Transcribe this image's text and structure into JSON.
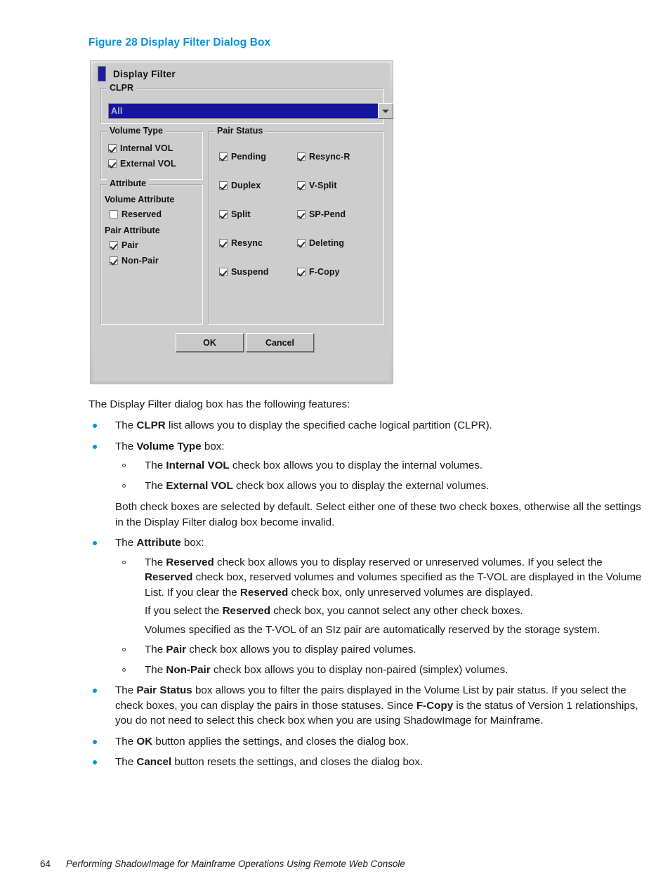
{
  "figure": {
    "caption": "Figure 28 Display Filter Dialog Box",
    "caption_color": "#0b93d5"
  },
  "dialog": {
    "title": "Display Filter",
    "title_icon": "application-icon",
    "clpr": {
      "legend": "CLPR",
      "selected_value": "All",
      "dropdown_icon": "chevron-down-icon"
    },
    "volume_type": {
      "legend": "Volume Type",
      "checkboxes": [
        {
          "label": "Internal VOL",
          "checked": true
        },
        {
          "label": "External VOL",
          "checked": true
        }
      ]
    },
    "attribute": {
      "legend": "Attribute",
      "volume_attribute_heading": "Volume Attribute",
      "volume_attribute_checkboxes": [
        {
          "label": "Reserved",
          "checked": false
        }
      ],
      "pair_attribute_heading": "Pair Attribute",
      "pair_attribute_checkboxes": [
        {
          "label": "Pair",
          "checked": true
        },
        {
          "label": "Non-Pair",
          "checked": true
        }
      ]
    },
    "pair_status": {
      "legend": "Pair Status",
      "column_left": [
        {
          "label": "Pending",
          "checked": true
        },
        {
          "label": "Duplex",
          "checked": true
        },
        {
          "label": "Split",
          "checked": true
        },
        {
          "label": "Resync",
          "checked": true
        },
        {
          "label": "Suspend",
          "checked": true
        }
      ],
      "column_right": [
        {
          "label": "Resync-R",
          "checked": true
        },
        {
          "label": "V-Split",
          "checked": true
        },
        {
          "label": "SP-Pend",
          "checked": true
        },
        {
          "label": "Deleting",
          "checked": true
        },
        {
          "label": "F-Copy",
          "checked": true
        }
      ]
    },
    "buttons": {
      "ok": "OK",
      "cancel": "Cancel"
    }
  },
  "body": {
    "lead": "The Display Filter dialog box has the following features:",
    "items": {
      "clpr": {
        "pre": "The ",
        "bold": "CLPR",
        "post": " list allows you to display the specified cache logical partition (CLPR)."
      },
      "volume_type": {
        "pre": "The ",
        "bold": "Volume Type",
        "post": " box:",
        "sub": {
          "internal": {
            "pre": "The ",
            "bold": "Internal VOL",
            "post": " check box allows you to display the internal volumes."
          },
          "external": {
            "pre": "The ",
            "bold": "External VOL",
            "post": " check box allows you to display the external volumes."
          }
        },
        "note": "Both check boxes are selected by default. Select either one of these two check boxes, otherwise all the settings in the Display Filter dialog box become invalid."
      },
      "attribute": {
        "pre": "The ",
        "bold": "Attribute",
        "post": " box:",
        "sub": {
          "reserved": {
            "p1_a": "The ",
            "p1_b1": "Reserved",
            "p1_b": " check box allows you to display reserved or unreserved volumes. If you select the ",
            "p1_b2": "Reserved",
            "p1_c": " check box, reserved volumes and volumes specified as the T-VOL are displayed in the Volume List. If you clear the ",
            "p1_b3": "Reserved",
            "p1_d": " check box, only unreserved volumes are displayed.",
            "p2_a": "If you select the ",
            "p2_b": "Reserved",
            "p2_c": " check box, you cannot select any other check boxes.",
            "p3": "Volumes specified as the T-VOL of an SIz pair are automatically reserved by the storage system."
          },
          "pair": {
            "pre": "The ",
            "bold": "Pair",
            "post": " check box allows you to display paired volumes."
          },
          "non_pair": {
            "pre": "The ",
            "bold": "Non-Pair",
            "post": " check box allows you to display non-paired (simplex) volumes."
          }
        }
      },
      "pair_status": {
        "pre": "The ",
        "bold": "Pair Status",
        "mid": " box allows you to filter the pairs displayed in the Volume List by pair status. If you select the check boxes, you can display the pairs in those statuses. Since ",
        "bold2": "F-Copy",
        "post": " is the status of Version 1 relationships, you do not need to select this check box when you are using ShadowImage for Mainframe."
      },
      "ok": {
        "pre": "The ",
        "bold": "OK",
        "post": " button applies the settings, and closes the dialog box."
      },
      "cancel": {
        "pre": "The ",
        "bold": "Cancel",
        "post": " button resets the settings, and closes the dialog box."
      }
    }
  },
  "footer": {
    "page_number": "64",
    "title": "Performing ShadowImage for Mainframe Operations Using Remote Web Console"
  }
}
